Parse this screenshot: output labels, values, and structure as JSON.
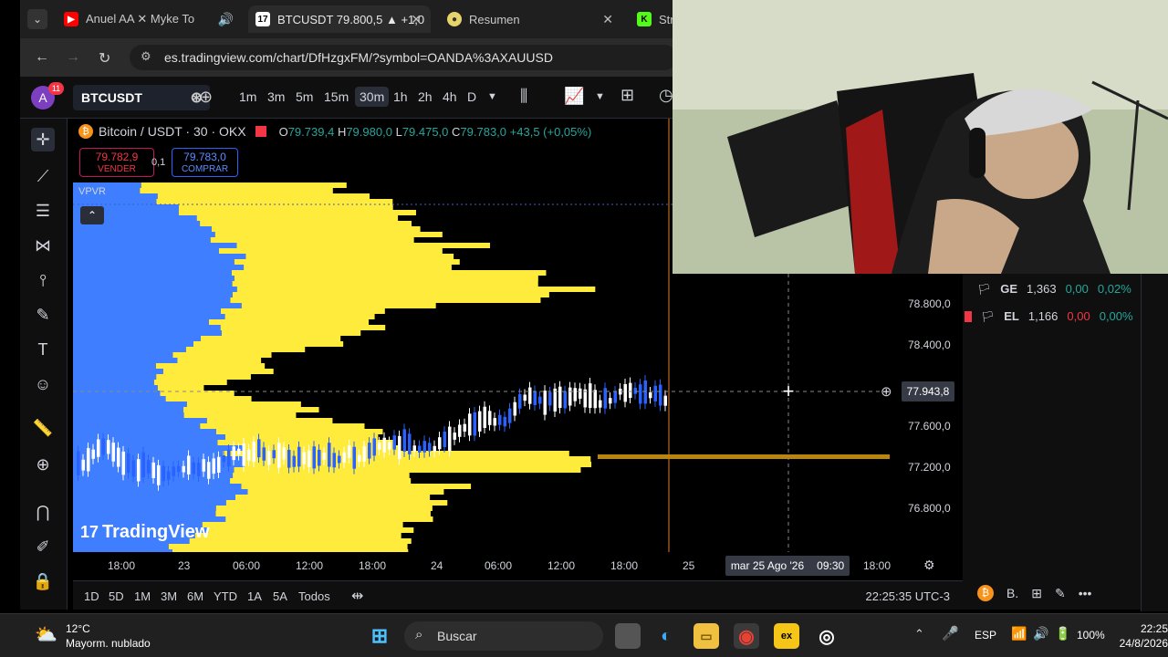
{
  "browser": {
    "tabs": [
      {
        "title": "Anuel AA ✕ Myke To",
        "active": false
      },
      {
        "title": "BTCUSDT 79.800,5 ▲ +1,0",
        "active": true
      },
      {
        "title": "Resumen",
        "active": false
      },
      {
        "title": "Stre",
        "active": false
      }
    ],
    "url": "es.tradingview.com/chart/DfHzgxFM/?symbol=OANDA%3AXAUUSD"
  },
  "toolbar": {
    "avatar": "A",
    "notif_count": "11",
    "symbol": "BTCUSDT",
    "timeframes": [
      "1m",
      "3m",
      "5m",
      "15m",
      "30m",
      "1h",
      "2h",
      "4h",
      "D"
    ],
    "selected_timeframe": "30m"
  },
  "legend": {
    "title": "Bitcoin / USDT · 30 · OKX",
    "o_label": "O",
    "o_val": "79.739,4",
    "h_label": "H",
    "h_val": "79.980,0",
    "l_label": "L",
    "l_val": "79.475,0",
    "c_label": "C",
    "c_val": "79.783,0",
    "change": "+43,5 (+0,05%)"
  },
  "trade": {
    "sell_price": "79.782,9",
    "sell_label": "VENDER",
    "spread": "0,1",
    "buy_price": "79.783,0",
    "buy_label": "COMPRAR"
  },
  "indicator": {
    "name": "VPVR"
  },
  "price_axis": [
    "78.800,0",
    "78.400,0",
    "77.600,0",
    "77.200,0",
    "76.800,0"
  ],
  "crosshair_price": "77.943,8",
  "time_axis": [
    "18:00",
    "23",
    "06:00",
    "12:00",
    "18:00",
    "24",
    "06:00",
    "12:00",
    "18:00",
    "25",
    "18:00"
  ],
  "crosshair_date": "mar 25 Ago '26",
  "crosshair_time": "09:30",
  "ranges": [
    "1D",
    "5D",
    "1M",
    "3M",
    "6M",
    "YTD",
    "1A",
    "5A",
    "Todos"
  ],
  "clock": "22:25:35 UTC-3",
  "watermark": "TradingView",
  "watchlist": [
    {
      "sym": "GE",
      "price": "1,363",
      "chg": "0,00",
      "pct": "0,02%"
    },
    {
      "sym": "EL",
      "price": "1,166",
      "chg": "0,00",
      "pct": "0,00%"
    }
  ],
  "bottom_panel": {
    "label": "B."
  },
  "taskbar": {
    "weather_temp": "12°C",
    "weather_desc": "Mayorm. nublado",
    "search": "Buscar",
    "lang": "ESP",
    "battery": "100%",
    "time": "22:25",
    "date": "24/8/2026"
  },
  "colors": {
    "bg": "#000000",
    "vp_up": "#3f7fff",
    "vp_down": "#ffeb3b",
    "poc": "#b8860b",
    "candle_up": "#2962ff",
    "candle_down": "#ffffff"
  }
}
